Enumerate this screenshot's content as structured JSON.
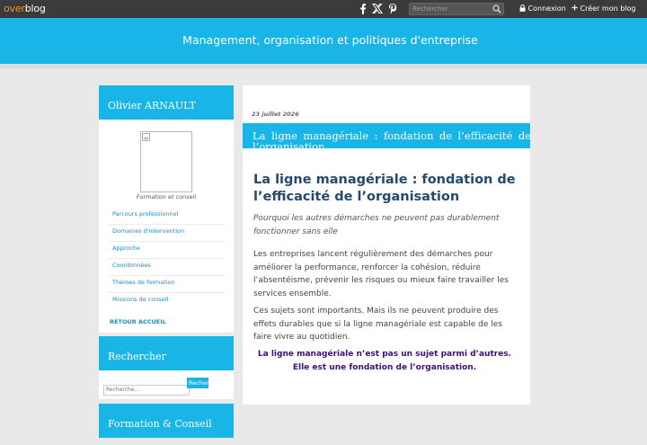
{
  "topbar": {
    "logo_part1": "over",
    "logo_part2": "blog",
    "social": [
      {
        "icon": "facebook-icon",
        "glyph": "f"
      },
      {
        "icon": "x-icon",
        "glyph": "𝕏"
      },
      {
        "icon": "pinterest-icon",
        "glyph": "P"
      }
    ],
    "search_placeholder": "Rechercher",
    "login_label": "Connexion",
    "create_blog_label": "Créer mon blog"
  },
  "header": {
    "blog_title": "Management, organisation et politiques d'entreprise"
  },
  "sidebar": {
    "profile_title": "Olivier ARNAULT",
    "profile_caption": "Formation et conseil",
    "menu": [
      "Parcours professionnel",
      "Domaines d'intervention",
      "Approche",
      "Coordonnées",
      "Thèmes de formation",
      "Missions de conseil"
    ],
    "back_home": "RETOUR ACCUEIL",
    "search_title": "Rechercher",
    "search_placeholder": "Recherche...",
    "search_button": "Rechercher",
    "third_title": "Formation & Conseil"
  },
  "article": {
    "date": "23 juillet 2026",
    "band_title": "La ligne managériale : fondation de l’efficacité de l’organisation",
    "title": "La ligne managériale : fondation de l’efficacité de l’organisation",
    "subtitle": "Pourquoi les autres démarches ne peuvent pas durablement fonctionner sans elle",
    "para1": "Les entreprises lancent régulièrement des démarches pour améliorer la performance, renforcer la cohésion, réduire l’absentéisme, prévenir les risques ou mieux faire travailler les services ensemble.",
    "para2": "Ces sujets sont importants. Mais ils ne peuvent produire des effets durables que si la ligne managériale est capable de les faire vivre au quotidien.",
    "highlight": "La ligne managériale n’est pas un sujet parmi d’autres. Elle est une fondation de l’organisation."
  },
  "colors": {
    "brand_blue": "#19b5e6",
    "topbar": "#3b3b3b",
    "title_navy": "#244a6e",
    "highlight_purple": "#3d0f7a",
    "logo_orange": "#f7941d"
  }
}
